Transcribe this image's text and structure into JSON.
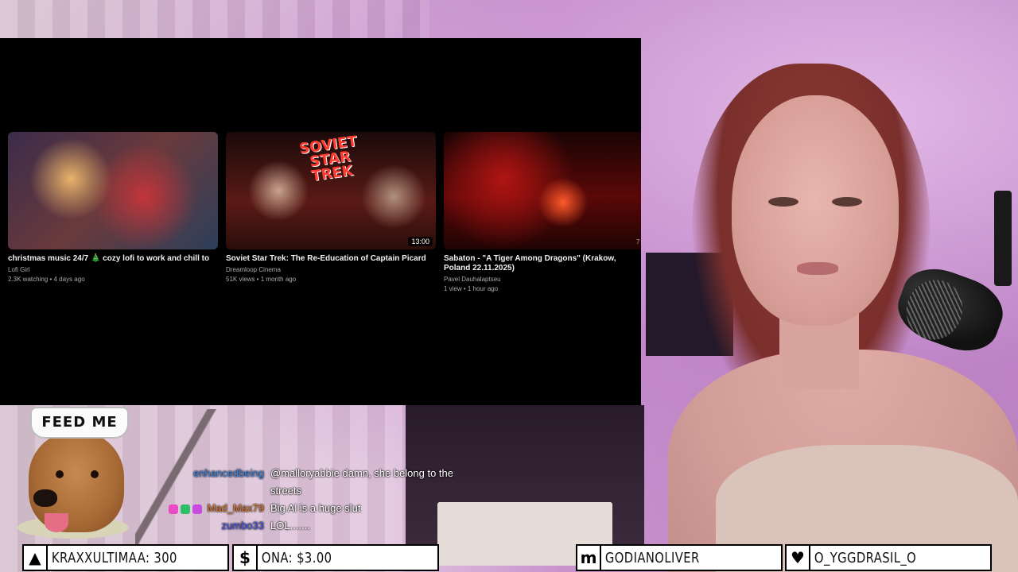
{
  "videos": [
    {
      "title": "christmas music 24/7 🎄 cozy lofi to work and chill to",
      "channel": "Lofi Girl",
      "meta": "2.3K watching • 4 days ago",
      "duration": ""
    },
    {
      "title": "Soviet Star Trek: The Re-Education of Captain Picard",
      "channel": "Dreamloop Cinema",
      "meta": "51K views • 1 month ago",
      "duration": "13:00",
      "thumb_logo": "SOVIET STAR TREK"
    },
    {
      "title": "Sabaton - \"A Tiger Among Dragons\" (Krakow, Poland 22.11.2025)",
      "channel": "Pavel Dauhalaptseu",
      "meta": "1 view • 1 hour ago",
      "duration": ""
    }
  ],
  "stray_duration": "7",
  "mascot": {
    "hat_text": "FEED ME"
  },
  "chat": [
    {
      "user": "enhancedbeing",
      "user_color": "#3b86e8",
      "message": "@malloryabbie damn, she belong to the streets"
    },
    {
      "user": "Mad_Max79",
      "user_color": "#e07a2a",
      "message": "Big Al is a huge slut",
      "badges": [
        "#e94bc4",
        "#2dbf67",
        "#c94be0"
      ]
    },
    {
      "user": "zumbo33",
      "user_color": "#4a56e8",
      "message": "LOL......."
    }
  ],
  "ticker": [
    {
      "icon": "diamond-icon",
      "glyph": "▲",
      "text": "KRAXXULTIMAA: 300"
    },
    {
      "icon": "dollar-icon",
      "glyph": "$",
      "text": "ONA: $3.00"
    },
    {
      "icon": "m-logo-icon",
      "glyph": "m",
      "text": "GODIANOLIVER"
    },
    {
      "icon": "heart-icon",
      "glyph": "♥",
      "text": "O_YGGDRASIL_O"
    }
  ]
}
